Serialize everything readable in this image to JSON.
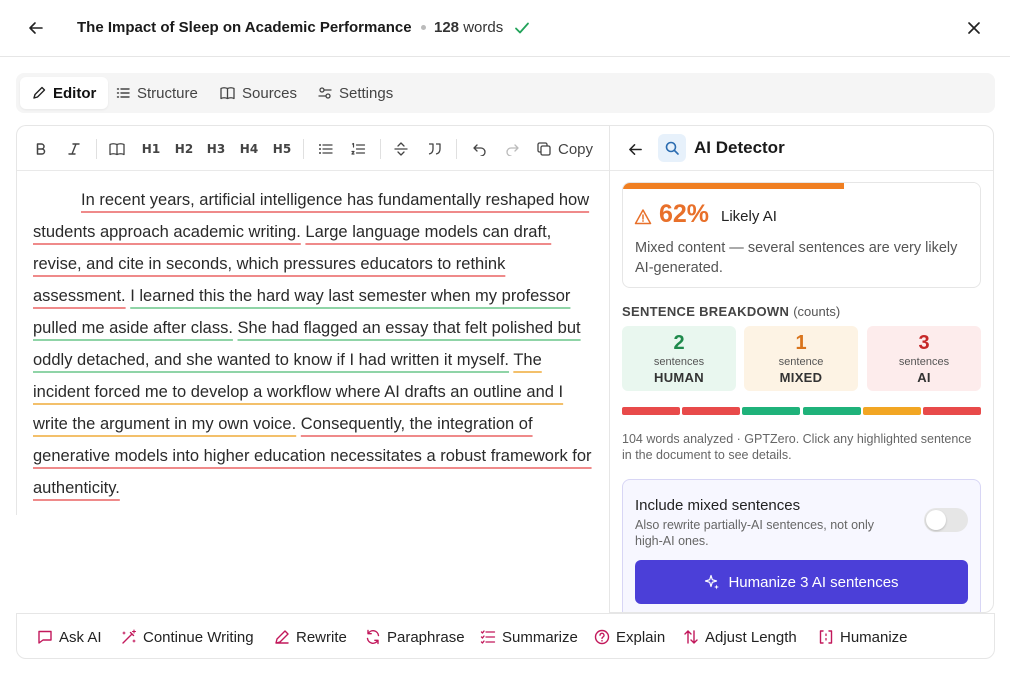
{
  "header": {
    "title": "The Impact of Sleep on Academic Performance",
    "word_count": "128",
    "word_unit": "words"
  },
  "tabs": [
    {
      "label": "Editor",
      "active": true
    },
    {
      "label": "Structure",
      "active": false
    },
    {
      "label": "Sources",
      "active": false
    },
    {
      "label": "Settings",
      "active": false
    }
  ],
  "toolbar": {
    "heading_labels": [
      "H1",
      "H2",
      "H3",
      "H4",
      "H5"
    ],
    "copy_label": "Copy"
  },
  "document": {
    "sentences": [
      {
        "text": "In recent years, artificial intelligence has fundamentally reshaped how students approach academic writing.",
        "class": "ai"
      },
      {
        "text": "Large language models can draft, revise, and cite in seconds, which pressures educators to rethink assessment.",
        "class": "ai"
      },
      {
        "text": "I learned this the hard way last semester when my professor pulled me aside after class.",
        "class": "human"
      },
      {
        "text": "She had flagged an essay that felt polished but oddly detached, and she wanted to know if I had written it myself.",
        "class": "human"
      },
      {
        "text": "The incident forced me to develop a workflow where AI drafts an outline and I write the argument in my own voice.",
        "class": "mixed"
      },
      {
        "text": "Consequently, the integration of generative models into higher education necessitates a robust framework for authenticity.",
        "class": "ai"
      }
    ]
  },
  "detector": {
    "title": "AI Detector",
    "score_percent": 62,
    "score_text": "62%",
    "verdict": "Likely AI",
    "description": "Mixed content — several sentences are very likely AI-generated.",
    "breakdown_title": "SENTENCE BREAKDOWN",
    "breakdown_note": "(counts)",
    "stats": [
      {
        "num": "2",
        "unit": "sentences",
        "cat": "HUMAN",
        "color": "#1f8a4c",
        "bg": "#e9f7ef"
      },
      {
        "num": "1",
        "unit": "sentence",
        "cat": "MIXED",
        "color": "#d9741c",
        "bg": "#fdf3e4"
      },
      {
        "num": "3",
        "unit": "sentences",
        "cat": "AI",
        "color": "#c62828",
        "bg": "#fdecec"
      }
    ],
    "segments": [
      "#e84a4a",
      "#e84a4a",
      "#1fb27a",
      "#1fb27a",
      "#f2a623",
      "#e84a4a"
    ],
    "meta": "104 words analyzed · GPTZero. Click any highlighted sentence in the document to see details.",
    "mixed_title": "Include mixed sentences",
    "mixed_sub": "Also rewrite partially-AI sentences, not only high-AI ones.",
    "mixed_enabled": false,
    "humanize_label": "Humanize 3 AI sentences"
  },
  "actions": [
    {
      "label": "Ask AI",
      "icon": "chat-icon"
    },
    {
      "label": "Continue Writing",
      "icon": "wand-icon"
    },
    {
      "label": "Rewrite",
      "icon": "pen-icon"
    },
    {
      "label": "Paraphrase",
      "icon": "refresh-icon"
    },
    {
      "label": "Summarize",
      "icon": "list-icon"
    },
    {
      "label": "Explain",
      "icon": "help-circle-icon"
    },
    {
      "label": "Adjust Length",
      "icon": "arrows-updown-icon"
    },
    {
      "label": "Humanize",
      "icon": "brackets-icon"
    }
  ],
  "colors": {
    "accent": "#4b3fd8",
    "score": "#e8702a",
    "ai_underline": "#ef8a8a",
    "human_underline": "#8fd4a7",
    "mixed_underline": "#f3c06b"
  }
}
